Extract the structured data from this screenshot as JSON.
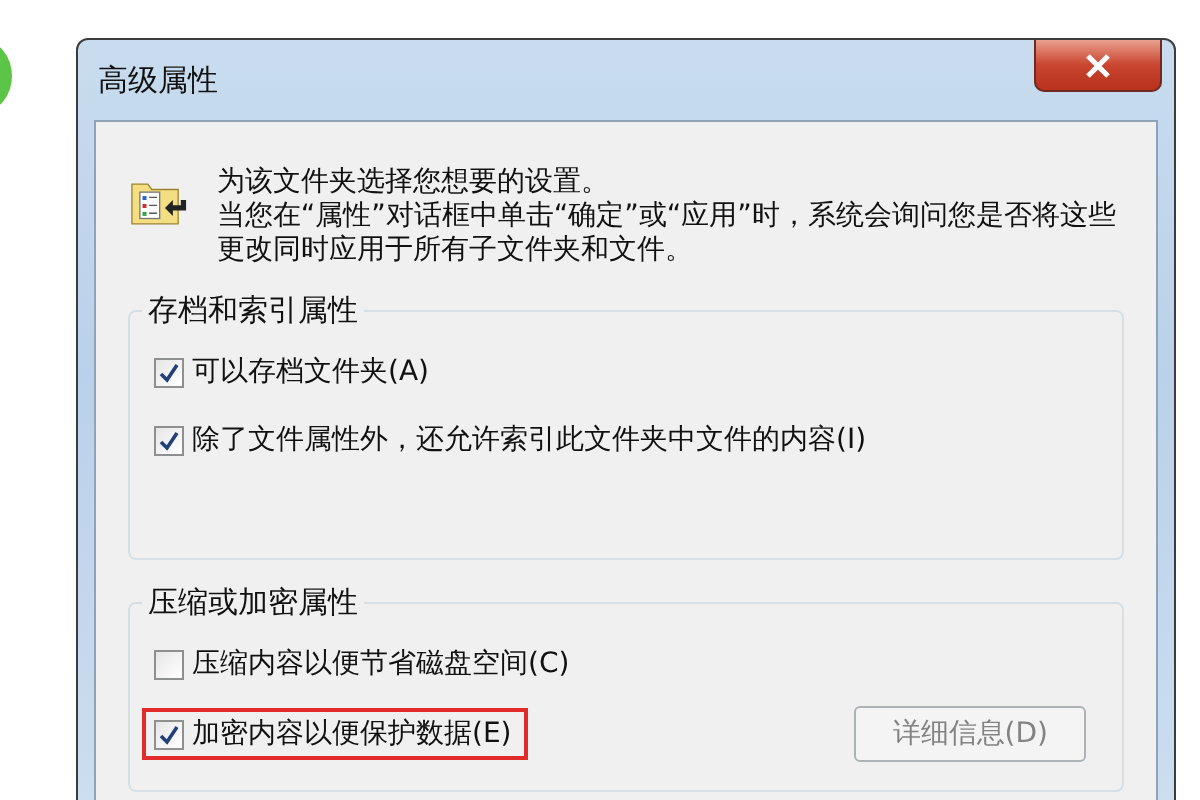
{
  "window": {
    "title": "高级属性"
  },
  "intro": [
    "为该文件夹选择您想要的设置。",
    "当您在“属性”对话框中单击“确定”或“应用”时，系统会询问您是否将这些更改同时应用于所有子文件夹和文件。"
  ],
  "groups": [
    {
      "legend": "存档和索引属性",
      "options": [
        {
          "label": "可以存档文件夹(A)",
          "checked": true,
          "highlighted": false
        },
        {
          "label": "除了文件属性外，还允许索引此文件夹中文件的内容(I)",
          "checked": true,
          "highlighted": false
        }
      ]
    },
    {
      "legend": "压缩或加密属性",
      "options": [
        {
          "label": "压缩内容以便节省磁盘空间(C)",
          "checked": false,
          "highlighted": false
        },
        {
          "label": "加密内容以便保护数据(E)",
          "checked": true,
          "highlighted": true
        }
      ],
      "button": {
        "label": "详细信息(D)",
        "disabled": true
      }
    }
  ]
}
